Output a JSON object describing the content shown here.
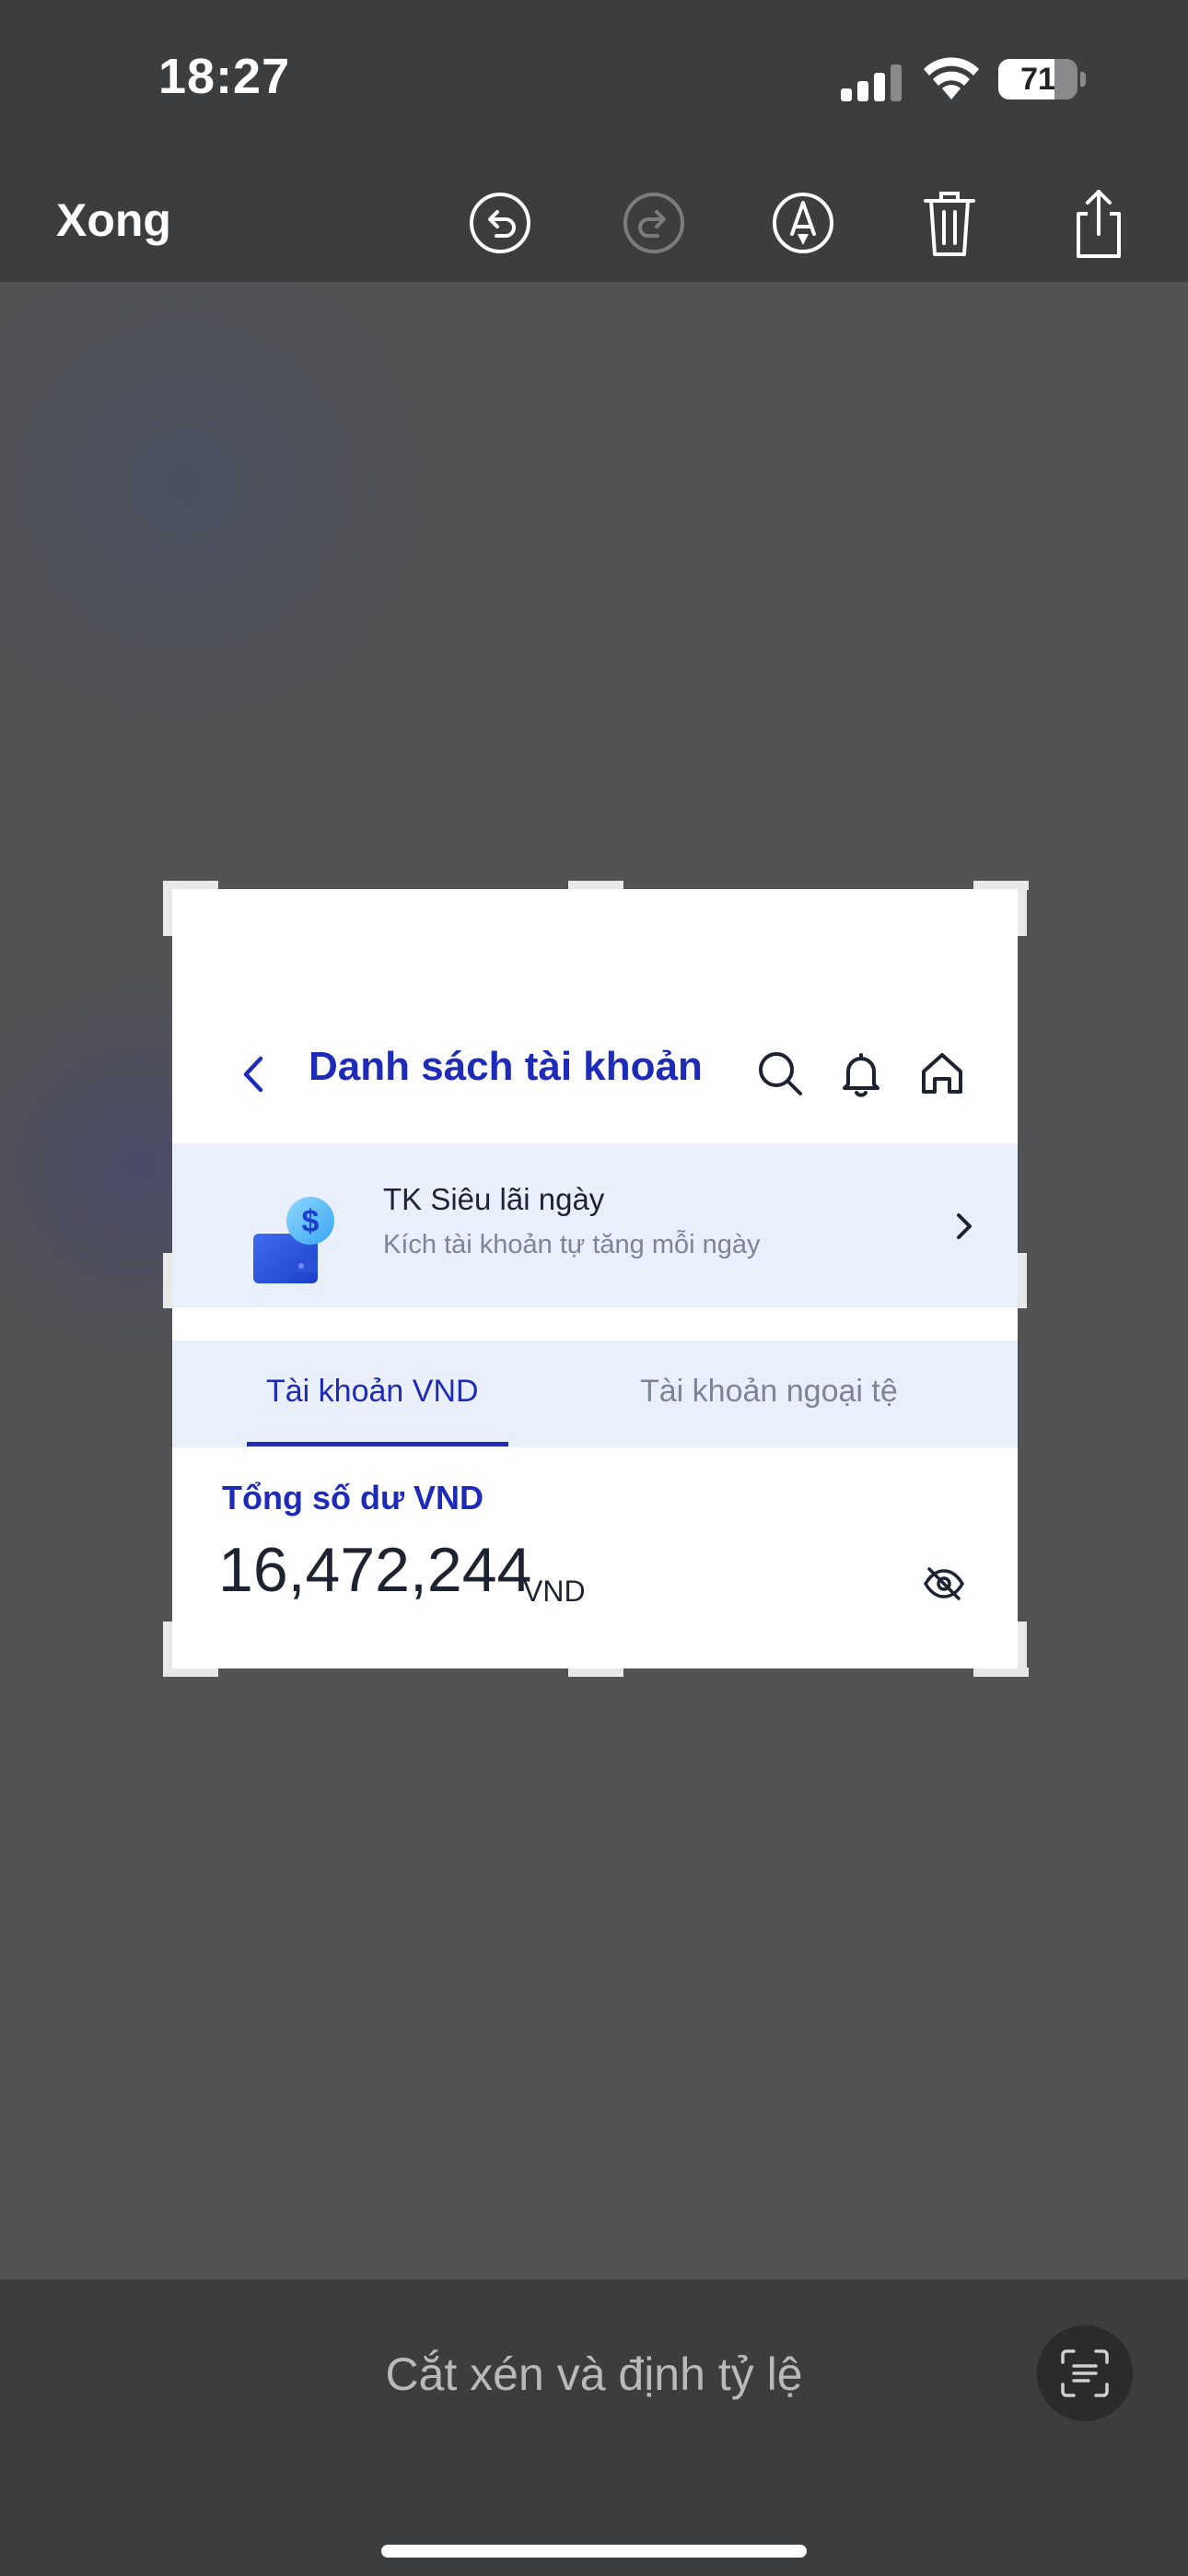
{
  "status_bar": {
    "time": "18:27",
    "battery": "71",
    "battery_level": 0.71
  },
  "toolbar": {
    "done_label": "Xong",
    "icons": [
      "undo-icon",
      "redo-icon",
      "markup-icon",
      "trash-icon",
      "share-icon"
    ]
  },
  "app": {
    "title": "Danh sách tài khoản",
    "promo": {
      "title": "TK Siêu lãi ngày",
      "subtitle": "Kích tài khoản tự tăng mỗi ngày"
    },
    "tabs": [
      {
        "label": "Tài khoản VND",
        "active": true
      },
      {
        "label": "Tài khoản ngoại tệ",
        "active": false
      }
    ],
    "balance": {
      "label": "Tổng số dư VND",
      "value": "16,472,244",
      "currency": "VND"
    }
  },
  "bottom": {
    "caption": "Cắt xén và định tỷ lệ"
  },
  "colors": {
    "accent": "#1e2bb8",
    "promo_bg": "#eaf0fb",
    "toolbar_bg": "#3c3d3f"
  }
}
